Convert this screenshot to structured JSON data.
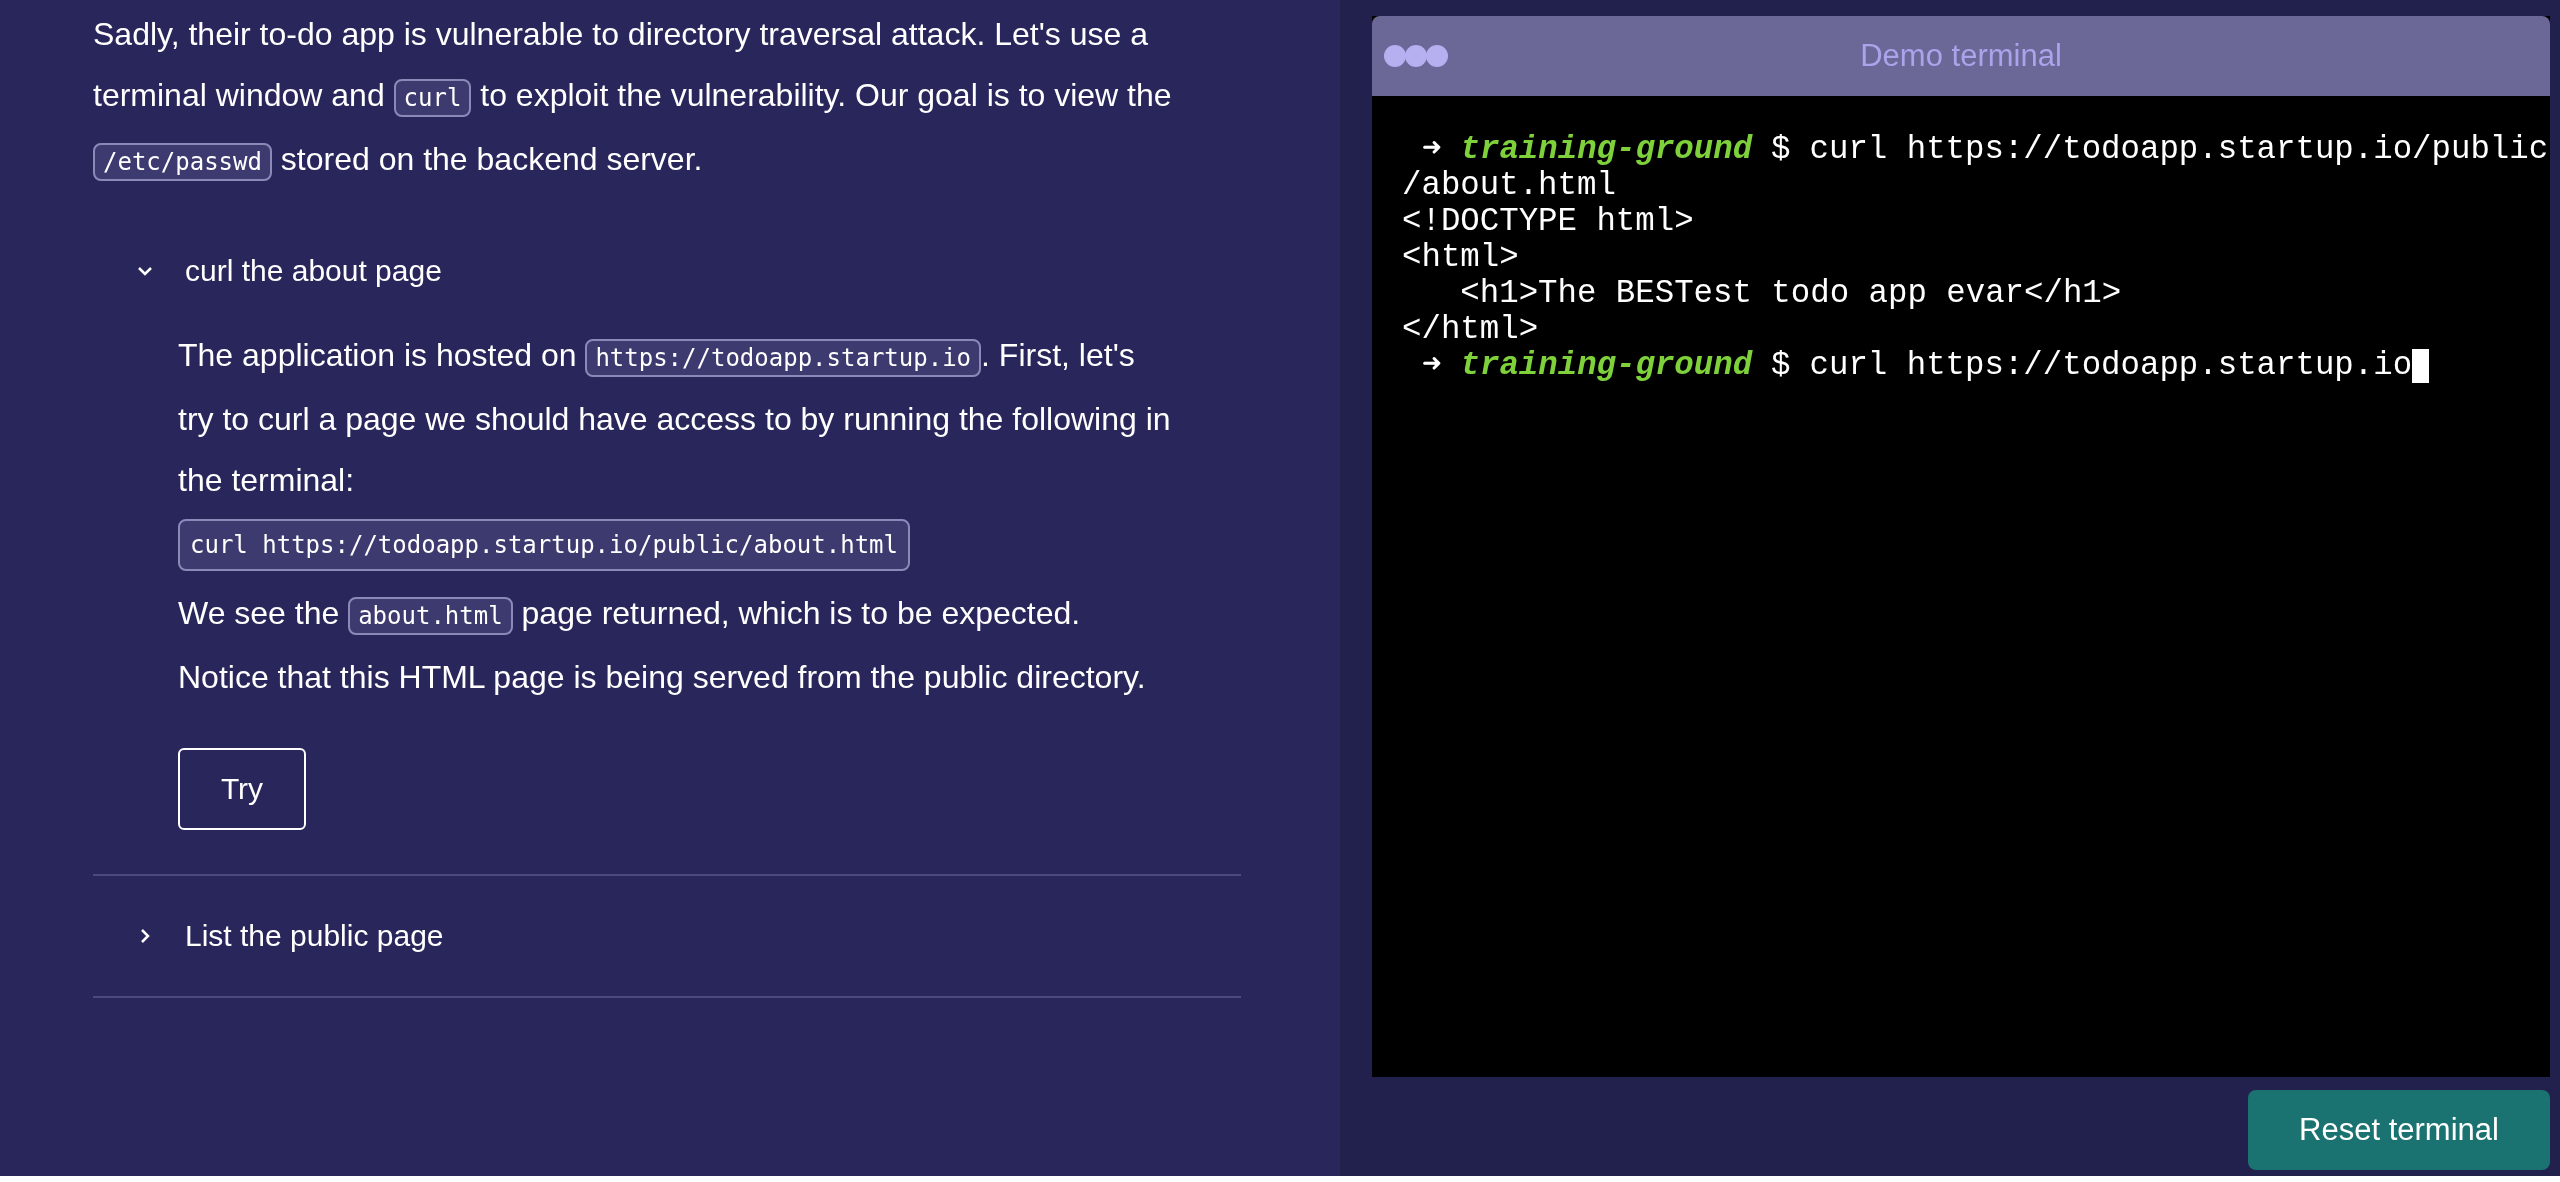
{
  "lesson": {
    "intro": [
      {
        "kind": "text",
        "text": "Sadly, their to-do app is vulnerable to directory traversal attack. Let's use a terminal window and "
      },
      {
        "kind": "code",
        "text": "curl"
      },
      {
        "kind": "text",
        "text": " to exploit the vulnerability. Our goal is to view the "
      },
      {
        "kind": "code",
        "text": "/etc/passwd"
      },
      {
        "kind": "text",
        "text": " stored on the backend server."
      }
    ],
    "sections": [
      {
        "title": "curl the about page",
        "expanded": true,
        "body": [
          {
            "kind": "paragraph",
            "segments": [
              {
                "kind": "text",
                "text": "The application is hosted on "
              },
              {
                "kind": "code",
                "text": "https://todoapp.startup.io"
              },
              {
                "kind": "text",
                "text": ". First, let's try to curl a page we should have access to by running the following in the terminal:"
              }
            ]
          },
          {
            "kind": "code_block",
            "text": "curl https://todoapp.startup.io/public/about.html"
          },
          {
            "kind": "paragraph",
            "segments": [
              {
                "kind": "text",
                "text": "We see the "
              },
              {
                "kind": "code",
                "text": "about.html"
              },
              {
                "kind": "text",
                "text": " page returned, which is to be expected. Notice that this HTML page is being served from the public directory."
              }
            ]
          },
          {
            "kind": "button",
            "label": "Try"
          }
        ]
      },
      {
        "title": "List the public page",
        "expanded": false
      }
    ]
  },
  "terminal": {
    "title": "Demo terminal",
    "lines": [
      {
        "kind": "prompt",
        "arrow": "➜",
        "host": "training-ground",
        "symbol": "$",
        "command": "curl https://todoapp.startup.io/public",
        "cursor": false
      },
      {
        "kind": "output",
        "text": "/about.html"
      },
      {
        "kind": "output",
        "text": "<!DOCTYPE html>"
      },
      {
        "kind": "output",
        "text": "<html>"
      },
      {
        "kind": "output",
        "text": "   <h1>The BESTest todo app evar</h1>"
      },
      {
        "kind": "output",
        "text": "</html>"
      },
      {
        "kind": "prompt",
        "arrow": "➜",
        "host": "training-ground",
        "symbol": "$",
        "command": "curl https://todoapp.startup.io",
        "cursor": true
      }
    ],
    "reset_button": "Reset terminal"
  }
}
